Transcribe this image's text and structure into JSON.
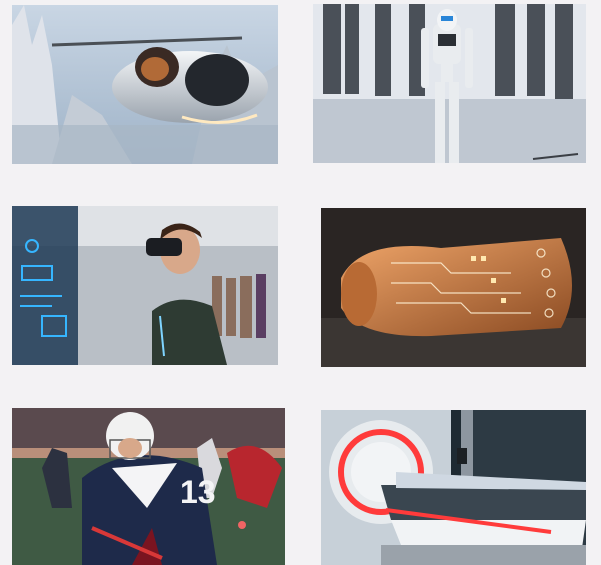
{
  "gallery": {
    "images": [
      {
        "subject": "flying-car",
        "jersey_number": null
      },
      {
        "subject": "humanoid-robot",
        "jersey_number": null
      },
      {
        "subject": "vr-headset-shopper",
        "jersey_number": null
      },
      {
        "subject": "flexible-circuit-board",
        "jersey_number": null
      },
      {
        "subject": "lacrosse-player",
        "jersey_number": "13"
      },
      {
        "subject": "mri-scanner",
        "jersey_number": null
      }
    ]
  },
  "colors": {
    "page_background": "#f3f2f4",
    "copper": "#d98a4e",
    "neon_red": "#ff3b3b",
    "hologram_blue": "#36b6ff"
  }
}
